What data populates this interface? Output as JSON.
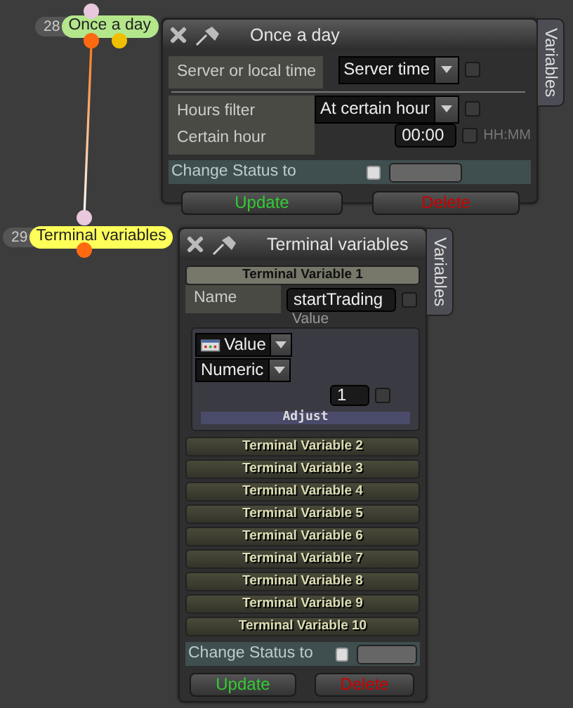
{
  "nodes": [
    {
      "number": "28",
      "label": "Once a day",
      "color": "#b4e68c"
    },
    {
      "number": "29",
      "label": "Terminal variables",
      "color": "#ffff5a"
    }
  ],
  "once_panel": {
    "title": "Once a day",
    "side_tab": "Variables",
    "groups": [
      [
        {
          "kind": "select",
          "label": "Server or local time",
          "value": "Server time",
          "checked": false
        }
      ],
      [
        {
          "kind": "select",
          "label": "Hours filter",
          "value": "At certain hour",
          "checked": false
        },
        {
          "kind": "time",
          "label": "Certain hour",
          "value": "00:00",
          "hint": "HH:MM",
          "checked": false
        }
      ]
    ],
    "change_status": {
      "label": "Change Status to",
      "checked": false
    },
    "buttons": [
      {
        "label": "Update",
        "kind": "update"
      },
      {
        "label": "Delete",
        "kind": "delete"
      }
    ]
  },
  "terminal_panel": {
    "title": "Terminal variables",
    "side_tab": "Variables",
    "variables": [
      {
        "title": "Terminal Variable 1",
        "expanded": true,
        "name_label": "Name",
        "name_value": "startTrading",
        "name_checked": false,
        "value_caption": "Value",
        "source": "Value",
        "type": "Numeric",
        "value": "1",
        "value_checked": false,
        "adjust": "Adjust"
      },
      {
        "title": "Terminal Variable 2",
        "expanded": false
      },
      {
        "title": "Terminal Variable 3",
        "expanded": false
      },
      {
        "title": "Terminal Variable 4",
        "expanded": false
      },
      {
        "title": "Terminal Variable 5",
        "expanded": false
      },
      {
        "title": "Terminal Variable 6",
        "expanded": false
      },
      {
        "title": "Terminal Variable 7",
        "expanded": false
      },
      {
        "title": "Terminal Variable 8",
        "expanded": false
      },
      {
        "title": "Terminal Variable 9",
        "expanded": false
      },
      {
        "title": "Terminal Variable 10",
        "expanded": false
      }
    ],
    "change_status": {
      "label": "Change Status to",
      "checked": false
    },
    "buttons": [
      {
        "label": "Update",
        "kind": "update"
      },
      {
        "label": "Delete",
        "kind": "delete"
      }
    ]
  }
}
